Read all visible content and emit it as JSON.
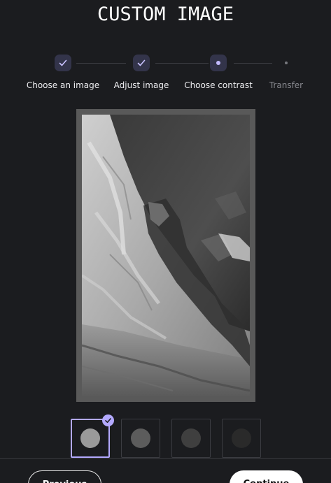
{
  "header": {
    "title": "CUSTOM IMAGE"
  },
  "stepper": {
    "steps": [
      {
        "label": "Choose an image",
        "state": "done"
      },
      {
        "label": "Adjust image",
        "state": "done"
      },
      {
        "label": "Choose contrast",
        "state": "current"
      },
      {
        "label": "Transfer",
        "state": "pending"
      }
    ]
  },
  "preview": {
    "description_icon": "mountain-photo"
  },
  "contrast": {
    "options": [
      {
        "name": "light",
        "color": "#9a9a9a",
        "selected": true
      },
      {
        "name": "medium",
        "color": "#5c5c5c",
        "selected": false
      },
      {
        "name": "dark",
        "color": "#3f3f3f",
        "selected": false
      },
      {
        "name": "darkest",
        "color": "#2a2a2a",
        "selected": false
      }
    ]
  },
  "footer": {
    "previous_label": "Previous",
    "continue_label": "Continue"
  },
  "colors": {
    "background": "#1b1c1f",
    "accent": "#b3a9ff",
    "step_bg": "#33344a"
  }
}
